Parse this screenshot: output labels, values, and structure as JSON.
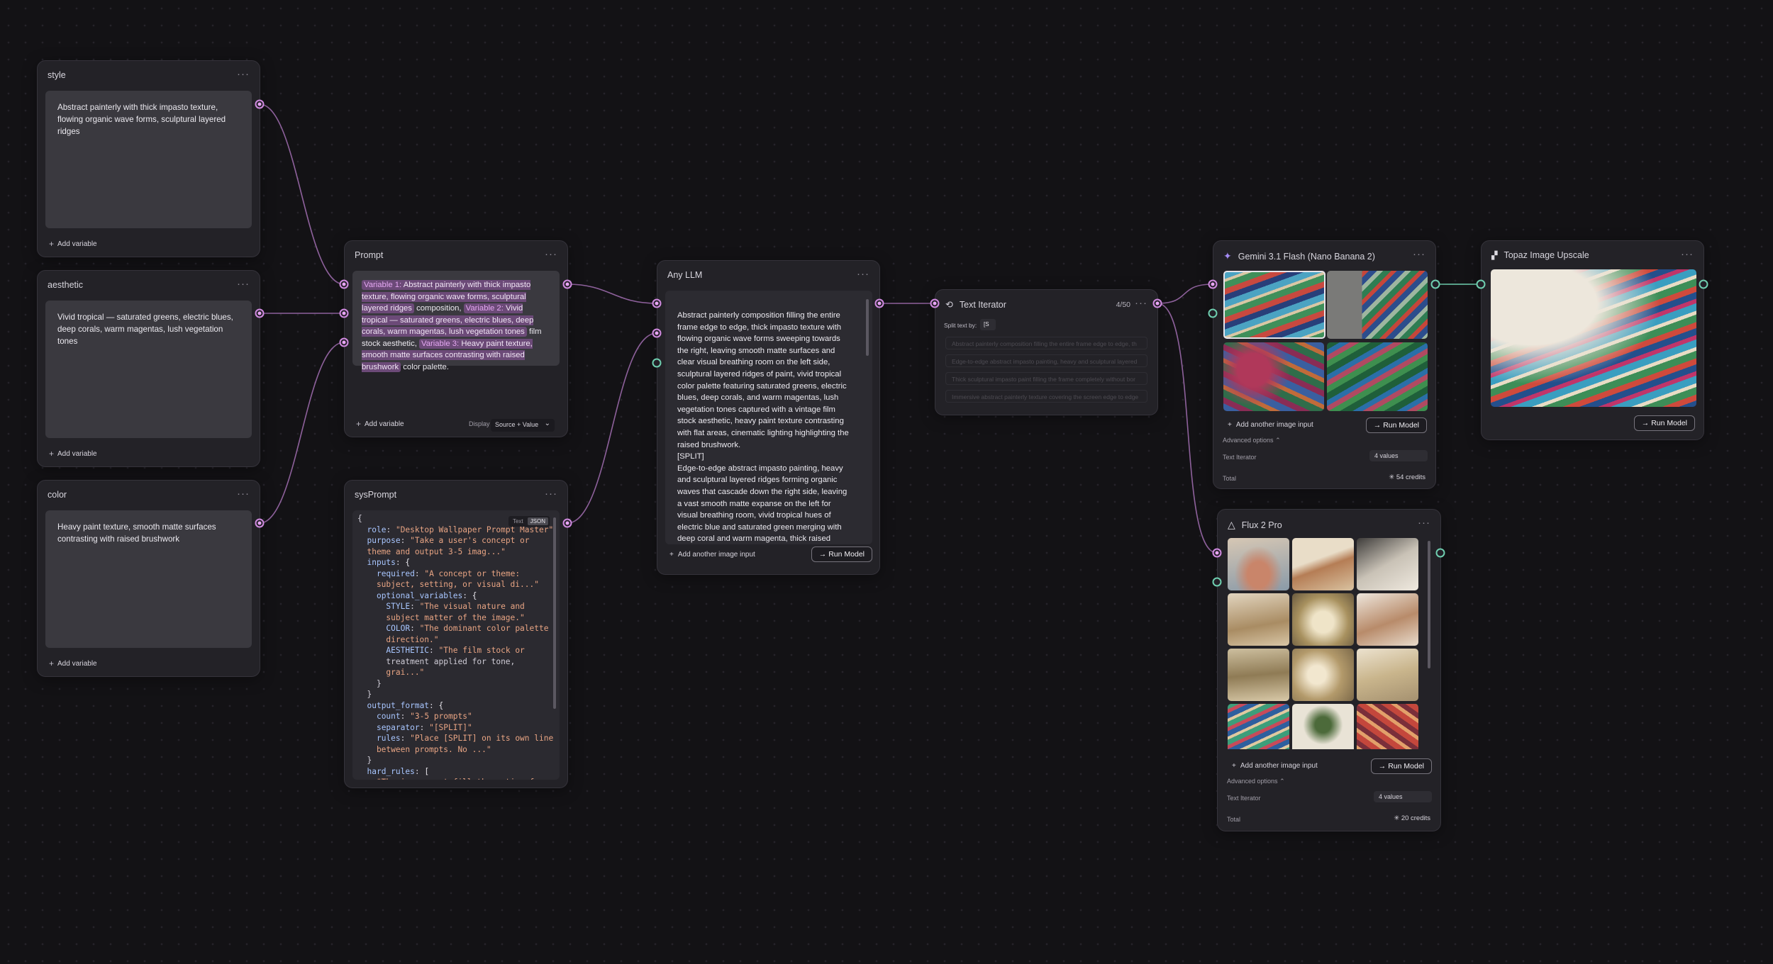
{
  "nodes": {
    "style": {
      "title": "style",
      "text": "Abstract painterly with thick impasto texture, flowing organic wave forms, sculptural layered ridges",
      "add": "Add variable"
    },
    "aesthetic": {
      "title": "aesthetic",
      "text": "Vivid tropical — saturated greens, electric blues, deep corals, warm magentas, lush vegetation tones",
      "add": "Add variable"
    },
    "color": {
      "title": "color",
      "text": "Heavy paint texture, smooth matte surfaces contrasting with raised brushwork",
      "add": "Add variable"
    },
    "prompt": {
      "title": "Prompt",
      "var1_tag": "Variable 1:",
      "var1": "Abstract painterly with thick impasto texture, flowing organic wave forms, sculptural layered ridges",
      "t1": "composition,",
      "var2_tag": "Variable 2:",
      "var2": "Vivid tropical — saturated greens, electric blues, deep corals, warm magentas, lush vegetation tones",
      "t2": "film stock aesthetic,",
      "var3_tag": "Variable 3:",
      "var3": "Heavy paint texture, smooth matte surfaces contrasting with raised brushwork",
      "t3": "color palette.",
      "add": "Add variable",
      "display_label": "Display",
      "display_value": "Source + Value"
    },
    "sysprompt": {
      "title": "sysPrompt",
      "tab_text": "Text",
      "tab_json": "JSON",
      "lines": [
        "{",
        "  role: \"Desktop Wallpaper Prompt Master\"",
        "  purpose: \"Take a user's concept or",
        "  theme and output 3-5 imag...\"",
        "  inputs: {",
        "    required: \"A concept or theme:",
        "    subject, setting, or visual di...\"",
        "    optional_variables: {",
        "      STYLE: \"The visual nature and",
        "      subject matter of the image.\"",
        "      COLOR: \"The dominant color palette",
        "      direction.\"",
        "      AESTHETIC: \"The film stock or",
        "      treatment applied for tone,",
        "      grai...\"",
        "    }",
        "  }",
        "  output_format: {",
        "    count: \"3-5 prompts\"",
        "    separator: \"[SPLIT]\"",
        "    rules: \"Place [SPLIT] on its own line",
        "    between prompts. No ...\"",
        "  }",
        "  hard_rules: [",
        "    \"The image must fill the entire frame"
      ]
    },
    "llm": {
      "title": "Any LLM",
      "output": "Abstract painterly composition filling the entire frame edge to edge, thick impasto texture with flowing organic wave forms sweeping towards the right, leaving smooth matte surfaces and clear visual breathing room on the left side, sculptural layered ridges of paint, vivid tropical color palette featuring saturated greens, electric blues, deep corals, and warm magentas, lush vegetation tones captured with a vintage film stock aesthetic, heavy paint texture contrasting with flat areas, cinematic lighting highlighting the raised brushwork.\n[SPLIT]\nEdge-to-edge abstract impasto painting, heavy and sculptural layered ridges forming organic waves that cascade down the right side, leaving a vast smooth matte expanse on the left for visual breathing room, vivid tropical hues of electric blue and saturated green merging with deep coral and warm magenta, thick raised",
      "add_image": "Add another image input",
      "run": "Run Model"
    },
    "iterator": {
      "title": "Text Iterator",
      "count": "4/50",
      "split_label": "Split text by:",
      "split_value": "[S",
      "items": [
        "Abstract painterly composition filling the entire frame edge to edge, th",
        "Edge-to-edge abstract impasto painting, heavy and sculptural layered",
        "Thick sculptural impasto paint filling the frame completely without bor",
        "Immersive abstract painterly texture covering the screen edge to edge"
      ]
    },
    "gemini": {
      "title": "Gemini 3.1 Flash (Nano Banana 2)",
      "add_image": "Add another image input",
      "run": "Run Model",
      "adv": "Advanced options",
      "row_label": "Text Iterator",
      "row_value": "4 values",
      "total": "Total",
      "credits": "54 credits"
    },
    "topaz": {
      "title": "Topaz Image Upscale",
      "run": "Run Model"
    },
    "flux": {
      "title": "Flux 2 Pro",
      "add_image": "Add another image input",
      "run": "Run Model",
      "adv": "Advanced options",
      "row_label": "Text Iterator",
      "row_value": "4 values",
      "total": "Total",
      "credits": "20 credits"
    }
  },
  "icons": {
    "menu": "more-horizontal-icon",
    "plus": "plus-icon",
    "arrow": "arrow-right-icon",
    "iterator": "repeat-icon",
    "gemini": "sparkle-icon",
    "topaz": "upscale-icon",
    "flux": "triangle-logo-icon",
    "credits": "credit-icon"
  },
  "colors": {
    "background": "#131215",
    "node": "#232227",
    "port": "#d08ae0",
    "port_green": "#6fcfb0",
    "wire": "#a06fb0",
    "chip": "#6c4a78"
  }
}
